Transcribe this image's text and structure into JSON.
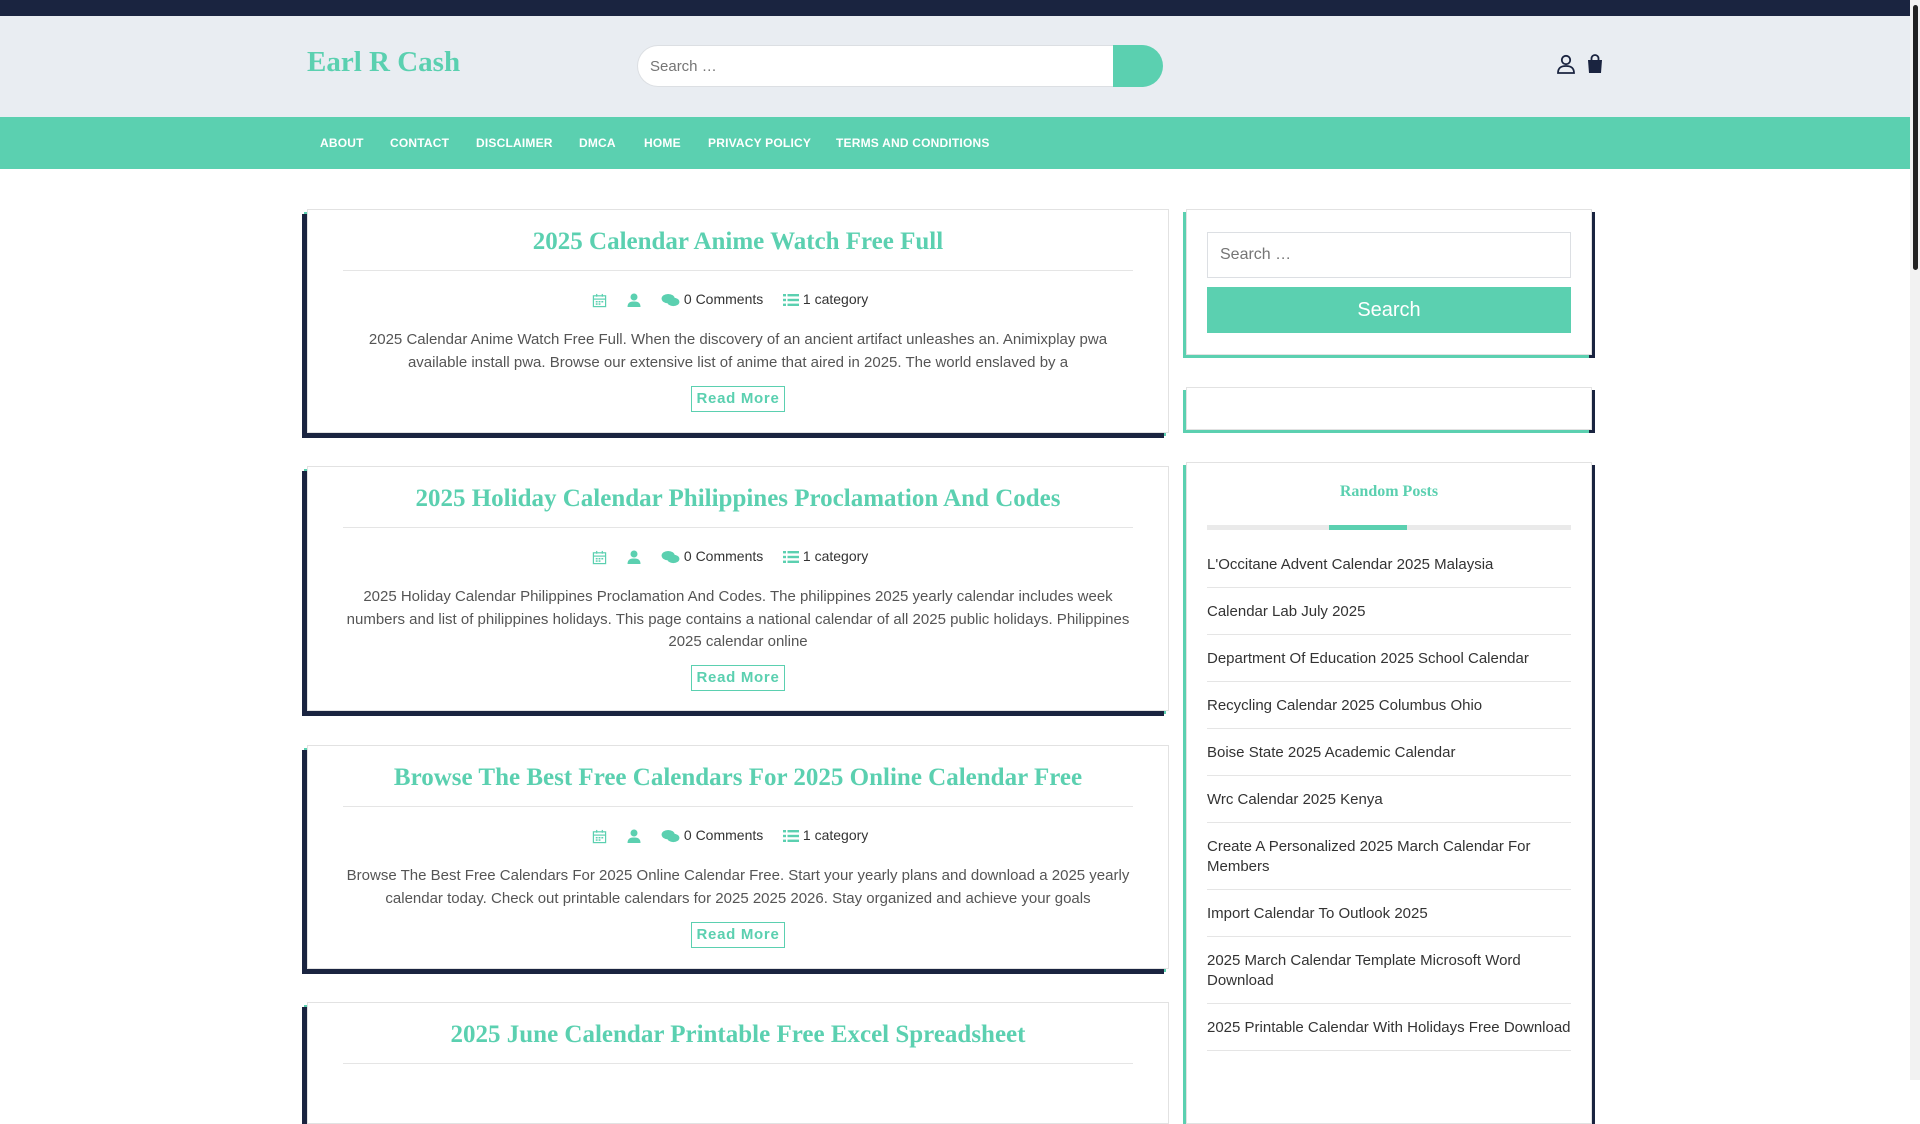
{
  "site": {
    "title": "Earl R Cash"
  },
  "header_search": {
    "placeholder": "Search …"
  },
  "icons": {
    "user": "user-icon",
    "cart": "shopping-bag-icon",
    "search": "search-icon"
  },
  "colors": {
    "accent": "#5bd0b0",
    "dark": "#1a2440",
    "header_bg": "#e9edf2"
  },
  "nav": {
    "items": [
      {
        "label": "ABOUT"
      },
      {
        "label": "CONTACT"
      },
      {
        "label": "DISCLAIMER"
      },
      {
        "label": "DMCA"
      },
      {
        "label": "HOME"
      },
      {
        "label": "PRIVACY POLICY"
      },
      {
        "label": "TERMS AND CONDITIONS"
      }
    ]
  },
  "posts": [
    {
      "title": "2025 Calendar Anime Watch Free Full",
      "comments": "0 Comments",
      "category": "1 category",
      "excerpt": "2025 Calendar Anime Watch Free Full. When the discovery of an ancient artifact unleashes an. Animixplay pwa available install pwa. Browse our extensive list of anime that aired in 2025. The world enslaved by a",
      "read_more": "Read More"
    },
    {
      "title": "2025 Holiday Calendar Philippines Proclamation And Codes",
      "comments": "0 Comments",
      "category": "1 category",
      "excerpt": "2025 Holiday Calendar Philippines Proclamation And Codes. The philippines 2025 yearly calendar includes week numbers and list of philippines holidays. This page contains a national calendar of all 2025 public holidays. Philippines 2025 calendar online",
      "read_more": "Read More"
    },
    {
      "title": "Browse The Best Free Calendars For 2025 Online Calendar Free",
      "comments": "0 Comments",
      "category": "1 category",
      "excerpt": "Browse The Best Free Calendars For 2025 Online Calendar Free. Start your yearly plans and download a 2025 yearly calendar today. Check out printable calendars for 2025 2025 2026. Stay organized and achieve your goals",
      "read_more": "Read More"
    },
    {
      "title": "2025 June Calendar Printable Free Excel Spreadsheet"
    }
  ],
  "sidebar": {
    "search": {
      "placeholder": "Search …",
      "button": "Search"
    },
    "random_posts": {
      "title": "Random Posts",
      "items": [
        "L'Occitane Advent Calendar 2025 Malaysia",
        "Calendar Lab July 2025",
        "Department Of Education 2025 School Calendar",
        "Recycling Calendar 2025 Columbus Ohio",
        "Boise State 2025 Academic Calendar",
        "Wrc Calendar 2025 Kenya",
        "Create A Personalized 2025 March Calendar For Members",
        "Import Calendar To Outlook 2025",
        "2025 March Calendar Template Microsoft Word Download",
        "2025 Printable Calendar With Holidays Free Download"
      ]
    }
  }
}
